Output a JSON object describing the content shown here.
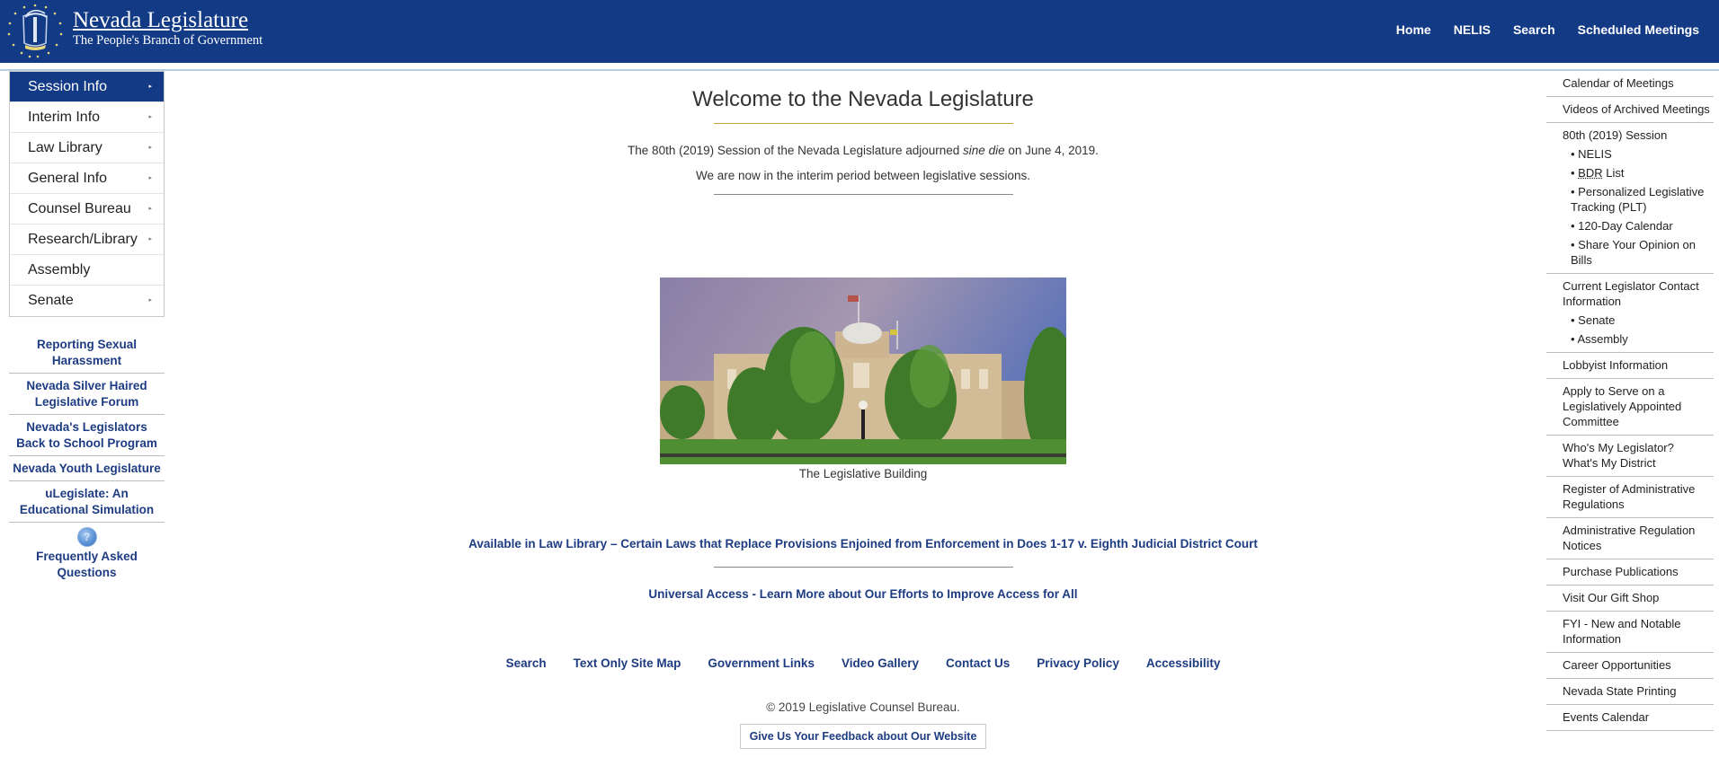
{
  "header": {
    "title": "Nevada Legislature",
    "subtitle": "The People's Branch of Government",
    "logo_icon": "nevada-state-seal",
    "nav": [
      "Home",
      "NELIS",
      "Search",
      "Scheduled Meetings"
    ]
  },
  "left_menu": {
    "items": [
      {
        "label": "Session Info",
        "active": true,
        "has_submenu": true
      },
      {
        "label": "Interim Info",
        "active": false,
        "has_submenu": true
      },
      {
        "label": "Law Library",
        "active": false,
        "has_submenu": true
      },
      {
        "label": "General Info",
        "active": false,
        "has_submenu": true
      },
      {
        "label": "Counsel Bureau",
        "active": false,
        "has_submenu": true
      },
      {
        "label": "Research/Library",
        "active": false,
        "has_submenu": true
      },
      {
        "label": "Assembly",
        "active": false,
        "has_submenu": false
      },
      {
        "label": "Senate",
        "active": false,
        "has_submenu": true
      }
    ],
    "caret_glyph": "▸"
  },
  "left_links": [
    "Reporting Sexual Harassment",
    "Nevada Silver Haired Legislative Forum",
    "Nevada's Legislators Back to School Program",
    "Nevada Youth Legislature",
    "uLegislate: An Educational Simulation"
  ],
  "faq": {
    "icon": "help-question-icon",
    "glyph": "?",
    "label": "Frequently Asked Questions"
  },
  "main": {
    "title": "Welcome to the Nevada Legislature",
    "session_text_before": "The 80th (2019) Session of the Nevada Legislature adjourned ",
    "session_text_italic": "sine die",
    "session_text_after": " on June 4, 2019.",
    "interim_text": "We are now in the interim period between legislative sessions.",
    "photo_caption": "The Legislative Building",
    "law_library_link": "Available in Law Library – Certain Laws that Replace Provisions Enjoined from Enforcement in Does 1-17 v. Eighth Judicial District Court",
    "universal_access_link": "Universal Access - Learn More about Our Efforts to Improve Access for All"
  },
  "footer": {
    "links": [
      "Search",
      "Text Only Site Map",
      "Government Links",
      "Video Gallery",
      "Contact Us",
      "Privacy Policy",
      "Accessibility"
    ],
    "copyright": "© 2019 Legislative Counsel Bureau.",
    "feedback_button": "Give Us Your Feedback about Our Website"
  },
  "right_menu": {
    "calendar": "Calendar of Meetings",
    "videos": "Videos of Archived Meetings",
    "session": {
      "label": "80th (2019) Session",
      "subs": [
        "NELIS",
        "BDR",
        "Personalized Legislative Tracking (PLT)",
        "120-Day Calendar",
        "Share Your Opinion on Bills"
      ],
      "bdr_suffix": " List"
    },
    "contact": {
      "label": "Current Legislator Contact Information",
      "subs": [
        "Senate",
        "Assembly"
      ]
    },
    "rest": [
      "Lobbyist Information",
      "Apply to Serve on a Legislatively Appointed Committee",
      "Who's My Legislator? What's My District",
      "Register of Administrative Regulations",
      "Administrative Regulation Notices",
      "Purchase Publications",
      "Visit Our Gift Shop",
      "FYI - New and Notable Information",
      "Career Opportunities",
      "Nevada State Printing",
      "Events Calendar"
    ],
    "bullet": "• "
  },
  "colors": {
    "header_bg": "#133a85",
    "link": "#1e3c82",
    "gold_rule": "#c9a23a"
  }
}
